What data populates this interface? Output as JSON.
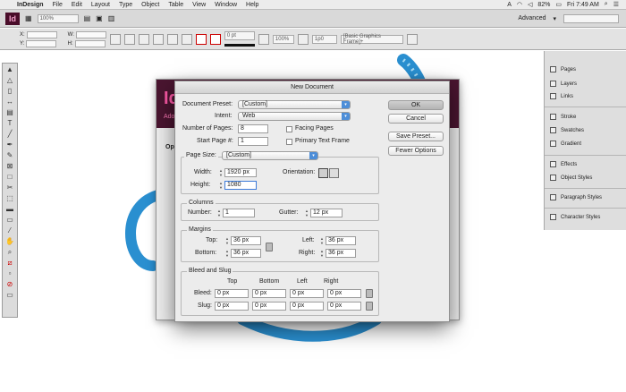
{
  "menubar": {
    "app": "InDesign",
    "items": [
      "File",
      "Edit",
      "Layout",
      "Type",
      "Object",
      "Table",
      "View",
      "Window",
      "Help"
    ],
    "battery": "82%",
    "clock": "Fri 7:49 AM"
  },
  "appbar": {
    "logo": "Id",
    "zoom": "100%",
    "workspace": "Advanced"
  },
  "control": {
    "x_label": "X:",
    "y_label": "Y:",
    "w_label": "W:",
    "h_label": "H:",
    "stroke_weight": "0 pt",
    "percent": "100%",
    "right_value": "1p0",
    "frame_style": "[Basic Graphics Frame]+"
  },
  "welcome": {
    "logo": "Id",
    "subtitle": "Ado",
    "open_label": "Ope"
  },
  "dialog": {
    "title": "New Document",
    "preset_label": "Document Preset:",
    "preset_value": "[Custom]",
    "intent_label": "Intent:",
    "intent_value": "Web",
    "pages_label": "Number of Pages:",
    "pages_value": "8",
    "start_label": "Start Page #:",
    "start_value": "1",
    "facing_label": "Facing Pages",
    "primary_label": "Primary Text Frame",
    "pagesize_group": "Page Size:",
    "pagesize_value": "[Custom]",
    "width_label": "Width:",
    "width_value": "1920 px",
    "height_label": "Height:",
    "height_value": "1080",
    "orientation_label": "Orientation:",
    "columns_group": "Columns",
    "number_label": "Number:",
    "number_value": "1",
    "gutter_label": "Gutter:",
    "gutter_value": "12 px",
    "margins_group": "Margins",
    "top_label": "Top:",
    "top_value": "36 px",
    "bottom_label": "Bottom:",
    "bottom_value": "36 px",
    "left_label": "Left:",
    "left_value": "36 px",
    "right_label": "Right:",
    "right_value": "36 px",
    "bleed_group": "Bleed and Slug",
    "col_top": "Top",
    "col_bottom": "Bottom",
    "col_left": "Left",
    "col_right": "Right",
    "bleed_label": "Bleed:",
    "bleed_values": [
      "0 px",
      "0 px",
      "0 px",
      "0 px"
    ],
    "slug_label": "Slug:",
    "slug_values": [
      "0 px",
      "0 px",
      "0 px",
      "0 px"
    ],
    "ok": "OK",
    "cancel": "Cancel",
    "save_preset": "Save Preset...",
    "fewer_options": "Fewer Options"
  },
  "panels": {
    "items": [
      "Pages",
      "Layers",
      "Links",
      "Stroke",
      "Swatches",
      "Gradient",
      "Effects",
      "Object Styles",
      "Paragraph Styles",
      "Character Styles"
    ]
  }
}
